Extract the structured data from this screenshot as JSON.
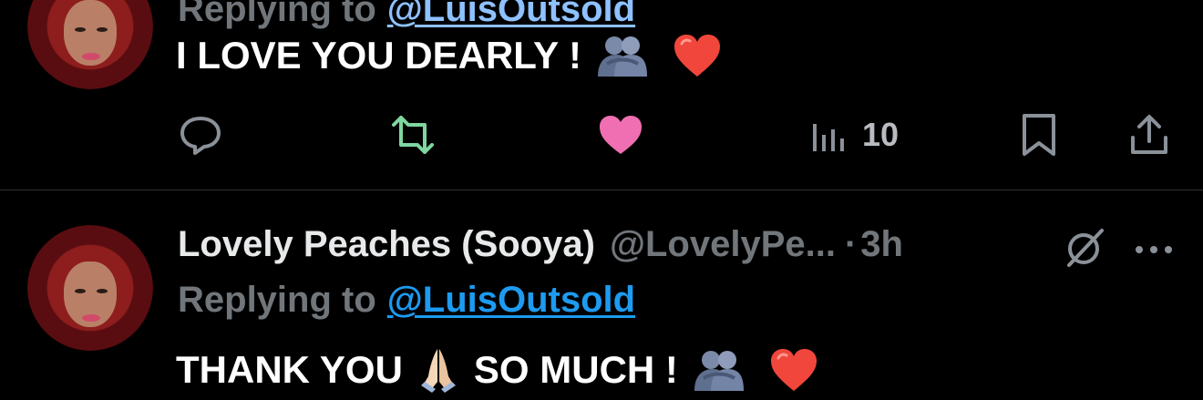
{
  "tweets": [
    {
      "replying_prefix": "Replying to",
      "mention": "@LuisOutsold",
      "text": "I LOVE YOU DEARLY !",
      "emojis": [
        "people-hugging",
        "red-heart"
      ],
      "stats": {
        "views": "10"
      },
      "liked": true
    },
    {
      "author_name": "Lovely Peaches (Sooya)",
      "author_handle": "@LovelyPe...",
      "separator": "·",
      "time": "3h",
      "replying_prefix": "Replying to",
      "mention": "@LuisOutsold",
      "text_part1": "THANK YOU",
      "text_part2": "SO MUCH !",
      "emojis": [
        "folded-hands",
        "people-hugging",
        "red-heart"
      ]
    }
  ],
  "colors": {
    "background": "#000000",
    "like_active": "#f06fb2",
    "retweet": "#7fd6a0",
    "mention": "#1d9bf0",
    "muted": "#71767b"
  }
}
